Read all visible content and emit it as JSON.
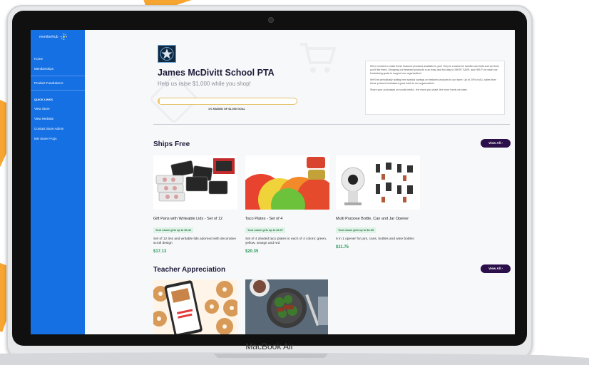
{
  "device": {
    "brand_label": "MacBook Air"
  },
  "sidebar": {
    "logo_text": "memberhub",
    "nav_items": [
      {
        "label": "Home"
      },
      {
        "label": "Memberships"
      },
      {
        "label": "Product Fundraisers"
      }
    ],
    "quick_links_heading": "QUICK LINKS",
    "quick_links": [
      {
        "label": "View Store"
      },
      {
        "label": "View Website"
      },
      {
        "label": "Contact Store Admin"
      },
      {
        "label": "MH Store FAQs"
      }
    ]
  },
  "header": {
    "org_name": "James McDivitt School PTA",
    "tagline": "Help us raise $1,000 while you shop!",
    "progress_percent": 1,
    "progress_label": "1% RAISED OF $1,000 GOAL",
    "info_paragraphs": [
      "We're excited to make these featured products available to you! They're curated for families and kids and we think you'll like them. Shopping our featured products is an easy and fun way to SHOP, SAVE, and HELP us reach our fundraising goals to support our organization!",
      "We'll be periodically adding new special savings on featured products to our store. Up to 20% of ALL sales from these product fundraisers goes back to our organization!",
      "Share your purchases on social media - the more you share, the more funds we raise."
    ]
  },
  "sections": [
    {
      "title": "Ships Free",
      "view_all_label": "View All  ›",
      "products": [
        {
          "title": "Gift Pans with Writeable Lids - Set of 12",
          "cause_text": "Your cause gets up to $3.42",
          "description": "Set of 12 tins and writable lids adorned with decorative scroll design",
          "price": "$17.13"
        },
        {
          "title": "Taco Plates - Set of 4",
          "cause_text": "Your cause gets up to $4.07",
          "description": "Set of 4 divided taco plates in each of 4 colors: green, yellow, orange and red",
          "price": "$20.35"
        },
        {
          "title": "Multi Purpose Bottle, Can and Jar Opener",
          "cause_text": "Your cause gets up to $2.35",
          "description": "6 in 1 opener for jars, cans, bottles and wine bottles",
          "price": "$11.75"
        }
      ]
    },
    {
      "title": "Teacher Appreciation",
      "view_all_label": "View All  ›"
    }
  ],
  "colors": {
    "sidebar_blue": "#1570e4",
    "brand_orange": "#f6a531",
    "title_navy": "#1e1c3a",
    "view_all_purple": "#2a0f4a",
    "price_green": "#2c9a5c",
    "cause_badge_bg": "#def3e6"
  },
  "icons": [
    "memberhub-logo-icon",
    "pta-star-logo-icon",
    "cart-watermark-icon",
    "tag-watermark-icon",
    "chevron-right-icon"
  ]
}
